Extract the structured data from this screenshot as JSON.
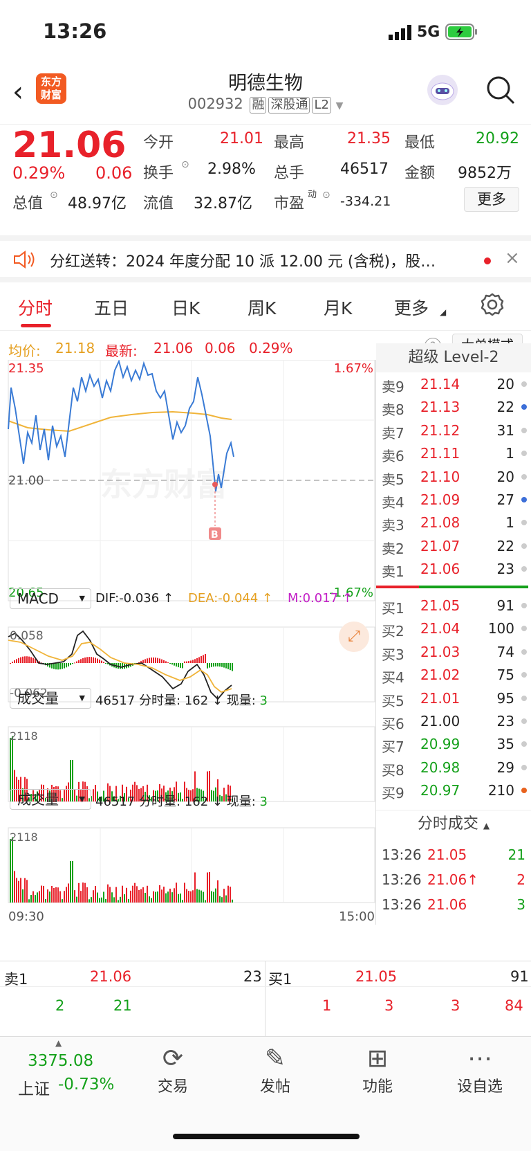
{
  "status": {
    "time": "13:26",
    "network": "5G"
  },
  "header": {
    "title": "明德生物",
    "code": "002932",
    "tags": [
      "融",
      "深股通",
      "L2"
    ],
    "logo_line1": "东方",
    "logo_line2": "财富"
  },
  "quote": {
    "price": "21.06",
    "pct": "0.29%",
    "chg": "0.06",
    "labels": {
      "open": "今开",
      "high": "最高",
      "low": "最低",
      "turnover": "换手",
      "volume": "总手",
      "amount": "金额",
      "total_cap": "总值",
      "float_cap": "流值",
      "pe": "市盈",
      "pe_sup": "动"
    },
    "open": "21.01",
    "high": "21.35",
    "low": "20.92",
    "turnover": "2.98%",
    "volume": "46517",
    "amount": "9852万",
    "total_cap": "48.97亿",
    "float_cap": "32.87亿",
    "pe": "-334.21",
    "more": "更多"
  },
  "notice": {
    "text": "分红送转：2024 年度分配 10 派 12.00 元 (含税)，股…"
  },
  "tabs": [
    "分时",
    "五日",
    "日K",
    "周K",
    "月K",
    "更多"
  ],
  "info_bar": {
    "avg_label": "均价:",
    "avg": "21.18",
    "latest_label": "最新:",
    "latest": "21.06",
    "chg": "0.06",
    "pct": "0.29%",
    "mode": "大单模式"
  },
  "chart": {
    "high": "21.35",
    "pre_close": "21.00",
    "low": "20.65",
    "pct_high": "1.67%",
    "pct_low": "-1.67%",
    "watermark": "东方财富",
    "marker": "B",
    "start_time": "09:30",
    "end_time": "15:00"
  },
  "macd": {
    "label": "MACD",
    "dif": "DIF:-0.036 ↑",
    "dea": "DEA:-0.044 ↑",
    "m": "M:0.017 ↑",
    "top": "0.058",
    "bottom": "-0.062"
  },
  "volume": {
    "label": "成交量",
    "total": "46517",
    "min_label": "分时量:",
    "min": "162 ↓",
    "now_label": "现量:",
    "now": "3",
    "max": "2118"
  },
  "book": {
    "title": "超级 Level-2",
    "asks": [
      {
        "l": "卖9",
        "p": "21.14",
        "v": "20",
        "c": "#ccc"
      },
      {
        "l": "卖8",
        "p": "21.13",
        "v": "22",
        "c": "#3d6fd8"
      },
      {
        "l": "卖7",
        "p": "21.12",
        "v": "31",
        "c": "#ccc"
      },
      {
        "l": "卖6",
        "p": "21.11",
        "v": "1",
        "c": "#ccc"
      },
      {
        "l": "卖5",
        "p": "21.10",
        "v": "20",
        "c": "#ccc"
      },
      {
        "l": "卖4",
        "p": "21.09",
        "v": "27",
        "c": "#3d6fd8"
      },
      {
        "l": "卖3",
        "p": "21.08",
        "v": "1",
        "c": "#ccc"
      },
      {
        "l": "卖2",
        "p": "21.07",
        "v": "22",
        "c": "#ccc"
      },
      {
        "l": "卖1",
        "p": "21.06",
        "v": "23",
        "c": "#ccc"
      }
    ],
    "bids": [
      {
        "l": "买1",
        "p": "21.05",
        "v": "91",
        "c": "#ccc"
      },
      {
        "l": "买2",
        "p": "21.04",
        "v": "100",
        "c": "#ccc"
      },
      {
        "l": "买3",
        "p": "21.03",
        "v": "74",
        "c": "#ccc"
      },
      {
        "l": "买4",
        "p": "21.02",
        "v": "75",
        "c": "#ccc"
      },
      {
        "l": "买5",
        "p": "21.01",
        "v": "95",
        "c": "#ccc"
      },
      {
        "l": "买6",
        "p": "21.00",
        "v": "23",
        "c": "#ccc"
      },
      {
        "l": "买7",
        "p": "20.99",
        "v": "35",
        "c": "#ccc"
      },
      {
        "l": "买8",
        "p": "20.98",
        "v": "29",
        "c": "#ccc"
      },
      {
        "l": "买9",
        "p": "20.97",
        "v": "210",
        "c": "#e8621e"
      }
    ]
  },
  "ticks": {
    "title": "分时成交",
    "rows": [
      {
        "t": "13:26",
        "p": "21.05",
        "v": "21",
        "pc": "red",
        "vc": "green"
      },
      {
        "t": "13:26",
        "p": "21.06↑",
        "v": "2",
        "pc": "red",
        "vc": "red"
      },
      {
        "t": "13:26",
        "p": "21.06",
        "v": "3",
        "pc": "red",
        "vc": "green"
      }
    ]
  },
  "level": {
    "ask_label": "卖1",
    "ask_price": "21.06",
    "ask_vol": "23",
    "bid_label": "买1",
    "bid_price": "21.05",
    "bid_vol": "91",
    "ask_queue": [
      "2",
      "21"
    ],
    "bid_queue": [
      "1",
      "3",
      "3",
      "84"
    ]
  },
  "nav": {
    "index_value": "3375.08",
    "index_name": "上证",
    "index_pct": "-0.73%",
    "items": [
      "交易",
      "发帖",
      "功能",
      "设自选"
    ]
  }
}
